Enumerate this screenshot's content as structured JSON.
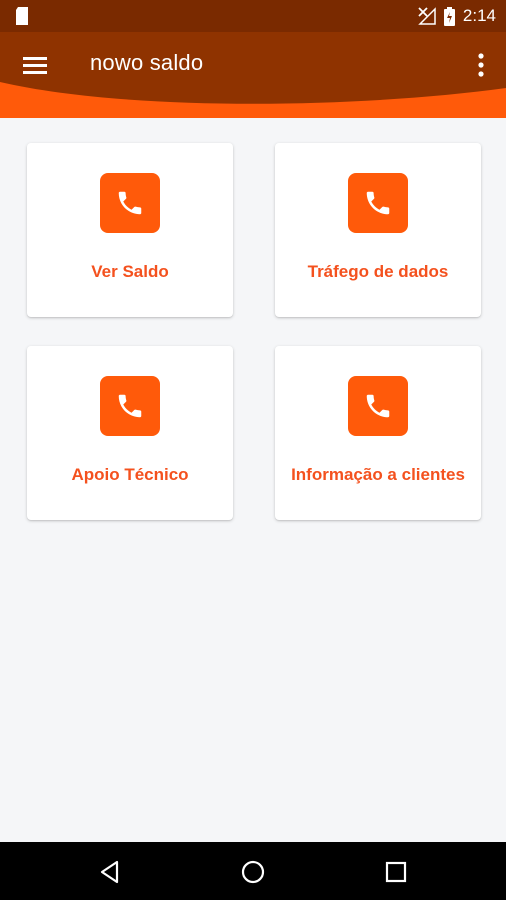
{
  "status_bar": {
    "time": "2:14",
    "icons": [
      "sim-card-icon",
      "no-signal-icon",
      "battery-charging-icon"
    ]
  },
  "app_bar": {
    "title": "nowo saldo",
    "menu_icon": "hamburger-menu-icon",
    "overflow_icon": "more-vert-icon"
  },
  "colors": {
    "primary_dark": "#8f3300",
    "accent": "#ff5a0a",
    "label": "#f4511e",
    "background": "#f5f6f8"
  },
  "cards": [
    {
      "label": "Ver Saldo",
      "icon": "phone-icon"
    },
    {
      "label": "Tráfego de dados",
      "icon": "phone-icon"
    },
    {
      "label": "Apoio Técnico",
      "icon": "phone-icon"
    },
    {
      "label": "Informação a clientes",
      "icon": "phone-icon"
    }
  ],
  "nav_bar": {
    "icons": [
      "back-icon",
      "home-icon",
      "recents-icon"
    ]
  }
}
